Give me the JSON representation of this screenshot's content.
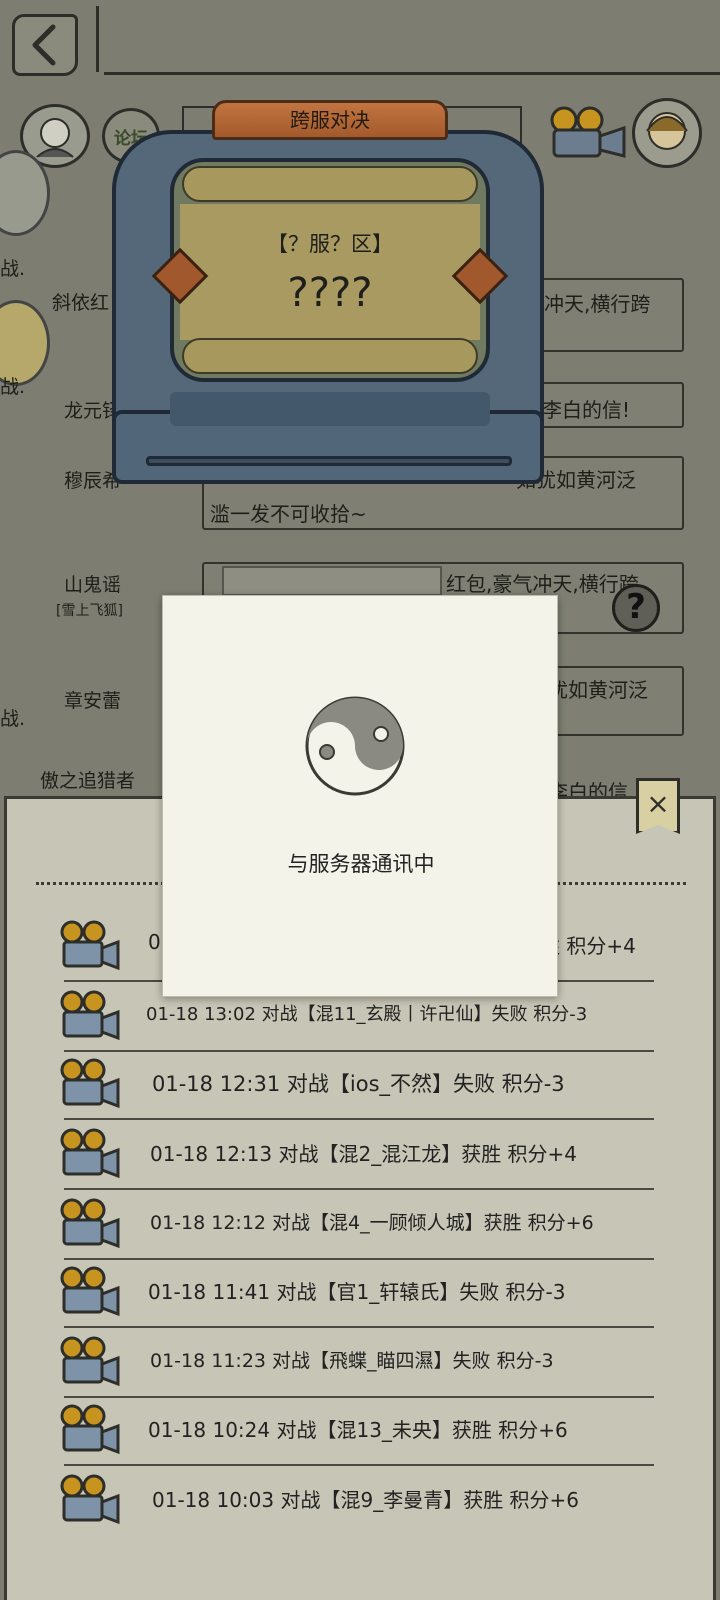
{
  "banner": {
    "title": "跨服对决",
    "server_label": "【？服？区】",
    "opponent_name": "????"
  },
  "background": {
    "tab_label": "论坛",
    "side_label_1": "战.",
    "side_label_2": "战.",
    "side_label_3": "战.",
    "chat": [
      {
        "name": "斜依红",
        "subname": "",
        "message": "冲天,横行跨"
      },
      {
        "name": "龙元铎",
        "subname": "",
        "message": "出李白的信!"
      },
      {
        "name": "穆辰希",
        "subname": "",
        "message": "如犹如黄河泛",
        "message2": "滥一发不可收拾~"
      },
      {
        "name": "山鬼谣",
        "subname": "[雪上飞狐]",
        "message": "红包,豪气冲天,横行跨"
      },
      {
        "name": "章安蕾",
        "subname": "",
        "message": "犹如黄河泛"
      },
      {
        "name": "傲之追猎者",
        "subname": "",
        "message": "李白的信"
      }
    ]
  },
  "panel": {
    "close_label": "×",
    "records": [
      {
        "text": "01-18 13:?? 对战【...】获胜 积分+4",
        "visible_text": "胜 积分+4",
        "prefix": "01"
      },
      {
        "text": "01-18 13:02 对战【混11_玄殿丨许卍仙】失败 积分-3"
      },
      {
        "text": "01-18 12:31 对战【ios_不然】失败 积分-3"
      },
      {
        "text": "01-18 12:13 对战【混2_混江龙】获胜 积分+4"
      },
      {
        "text": "01-18 12:12 对战【混4_一顾倾人城】获胜 积分+6"
      },
      {
        "text": "01-18 11:41 对战【官1_轩辕氏】失败 积分-3"
      },
      {
        "text": "01-18 11:23 对战【飛蝶_瞄四濕】失败 积分-3"
      },
      {
        "text": "01-18 10:24 对战【混13_未央】获胜 积分+6"
      },
      {
        "text": "01-18 10:03 对战【混9_李曼青】获胜 积分+6"
      }
    ]
  },
  "modal": {
    "status_text": "与服务器通讯中",
    "icon": "yin-yang-icon"
  },
  "help_label": "?",
  "icons": {
    "back": "back-chevron-icon",
    "record": "film-camera-icon",
    "close": "close-icon",
    "help": "help-icon"
  },
  "colors": {
    "overlay_bg": "#7d7e71",
    "panel_bg": "#c7c6b6",
    "modal_bg": "#f4f3ea",
    "banner_orange": "#b5663a",
    "machine_blue": "#55687a"
  }
}
